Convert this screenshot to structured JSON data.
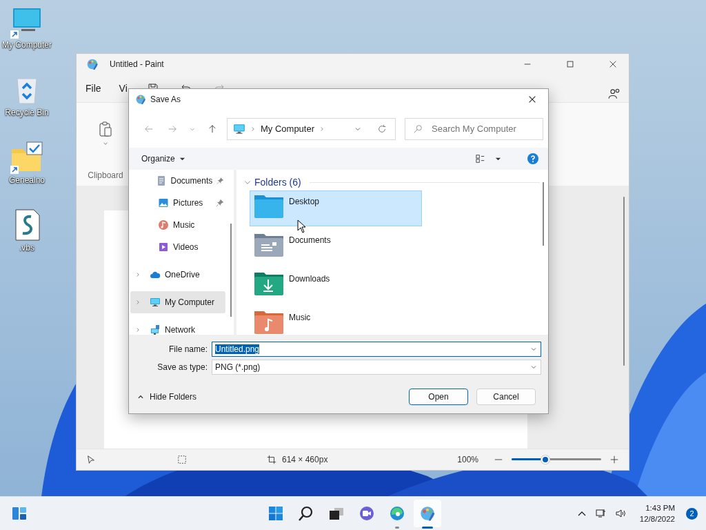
{
  "desktop_icons": [
    {
      "label": "My Computer",
      "kind": "computer",
      "shortcut": true
    },
    {
      "label": "Recycle Bin",
      "kind": "recycle",
      "shortcut": false
    },
    {
      "label": "Genealno",
      "kind": "folder-check",
      "shortcut": true
    },
    {
      "label": ".vbs",
      "kind": "script",
      "shortcut": false
    }
  ],
  "paint": {
    "title": "Untitled - Paint",
    "menu": [
      "File",
      "Vi"
    ],
    "clipboard_label": "Clipboard",
    "status": {
      "canvas_size": "614 × 460px",
      "zoom": "100%",
      "zoom_slider": {
        "level": 0.38
      }
    }
  },
  "dialog": {
    "title": "Save As",
    "address": {
      "segments": [
        "My Computer"
      ]
    },
    "search": {
      "placeholder": "Search My Computer"
    },
    "toolbar": {
      "organize": "Organize"
    },
    "nav": [
      {
        "label": "Documents",
        "kind": "documents",
        "pinned": true,
        "expandable": false,
        "selected": false
      },
      {
        "label": "Pictures",
        "kind": "pictures",
        "pinned": true,
        "expandable": false,
        "selected": false
      },
      {
        "label": "Music",
        "kind": "music",
        "pinned": false,
        "expandable": false,
        "selected": false
      },
      {
        "label": "Videos",
        "kind": "videos",
        "pinned": false,
        "expandable": false,
        "selected": false
      },
      {
        "label": "OneDrive",
        "kind": "cloud",
        "pinned": false,
        "expandable": true,
        "selected": false
      },
      {
        "label": "My Computer",
        "kind": "computer",
        "pinned": false,
        "expandable": true,
        "selected": true
      },
      {
        "label": "Network",
        "kind": "network",
        "pinned": false,
        "expandable": true,
        "selected": false
      }
    ],
    "section": {
      "label": "Folders (6)",
      "expanded": true
    },
    "folders": [
      {
        "label": "Desktop",
        "kind": "desktop",
        "selected": true
      },
      {
        "label": "Documents",
        "kind": "documents",
        "selected": false
      },
      {
        "label": "Downloads",
        "kind": "downloads",
        "selected": false
      },
      {
        "label": "Music",
        "kind": "music",
        "selected": false
      }
    ],
    "file_name": {
      "label": "File name:",
      "value": "Untitled.png",
      "text_selected": true
    },
    "save_type": {
      "label": "Save as type:",
      "value": "PNG (*.png)"
    },
    "hide_folders": "Hide Folders",
    "buttons": [
      {
        "label": "Open",
        "default": true
      },
      {
        "label": "Cancel",
        "default": false
      }
    ]
  },
  "taskbar": {
    "apps": [
      {
        "kind": "start",
        "running": false,
        "active": false
      },
      {
        "kind": "search",
        "running": false,
        "active": false
      },
      {
        "kind": "taskview",
        "running": false,
        "active": false
      },
      {
        "kind": "chat",
        "running": false,
        "active": false
      },
      {
        "kind": "edge",
        "running": true,
        "active": false
      },
      {
        "kind": "paint",
        "running": true,
        "active": true
      }
    ],
    "time": "1:43 PM",
    "date": "12/8/2022",
    "notifications": "2"
  }
}
